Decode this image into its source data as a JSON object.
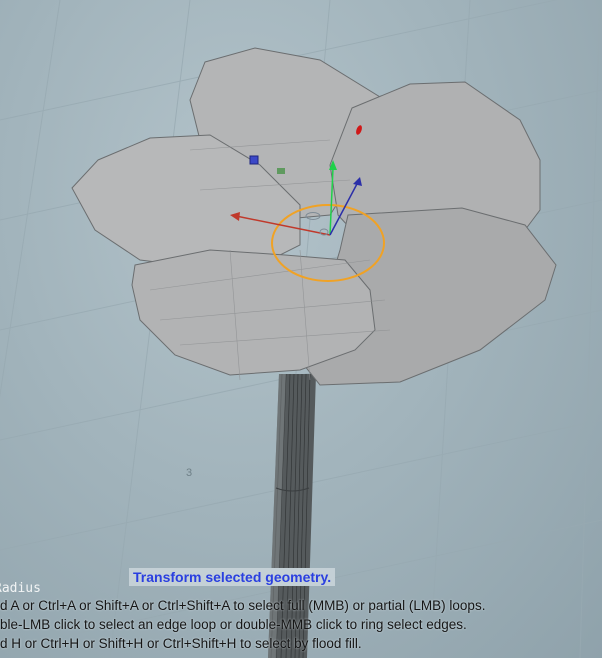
{
  "viewport": {
    "background_color": "#a6b7bf",
    "object": "flower-model",
    "gizmo": {
      "axes": [
        "x",
        "y",
        "z"
      ],
      "colors": {
        "x": "#c0392b",
        "y": "#1fd14a",
        "z": "#2b2fa8",
        "ring": "#f0a225"
      }
    },
    "grid_labels": [
      "3"
    ]
  },
  "hud": {
    "radius_label": "Radius",
    "operation_title": "Transform selected geometry.",
    "hints": [
      "d A or Ctrl+A or Shift+A or Ctrl+Shift+A to select full (MMB) or partial (LMB) loops.",
      "ble-LMB click to select an edge loop or double-MMB click to ring select edges.",
      "d H or Ctrl+H or Shift+H or Ctrl+Shift+H to select by flood fill."
    ]
  }
}
